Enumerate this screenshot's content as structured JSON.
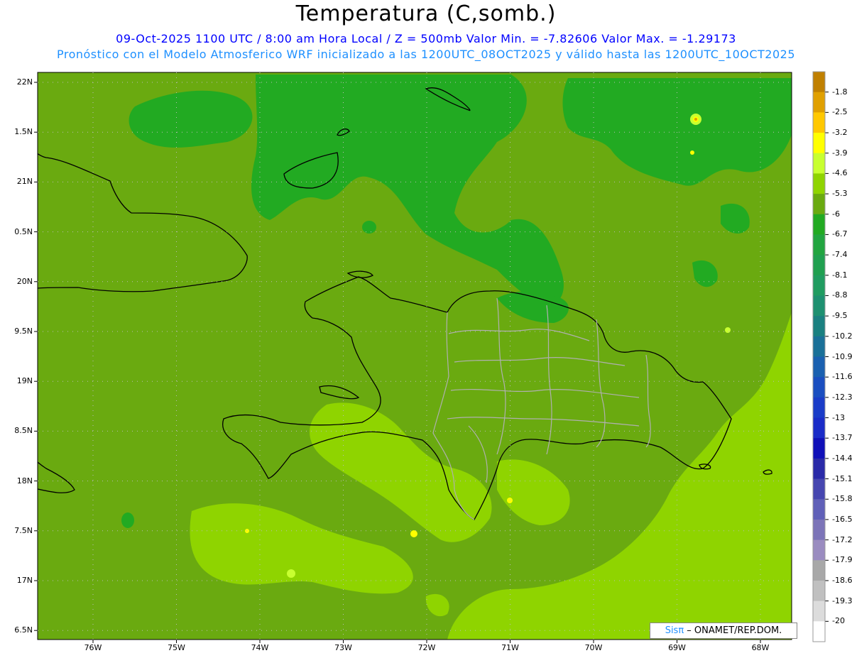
{
  "header": {
    "title": "Temperatura (C,somb.)",
    "line1": "09-Oct-2025  1100 UTC / 8:00 am Hora Local / Z = 500mb  Valor Min. = -7.82606  Valor Max. = -1.29173",
    "line2": "Pronóstico con el Modelo Atmosferico WRF inicializado a las 1200UTC_08OCT2025 y válido hasta las  1200UTC_10OCT2025"
  },
  "axes": {
    "lat_labels": [
      "22N",
      "1.5N",
      "21N",
      "0.5N",
      "20N",
      "9.5N",
      "19N",
      "8.5N",
      "18N",
      "7.5N",
      "17N",
      "6.5N"
    ],
    "lon_labels": [
      "76W",
      "75W",
      "74W",
      "73W",
      "72W",
      "71W",
      "70W",
      "69W",
      "68W"
    ]
  },
  "colorbar": {
    "labels": [
      "-1.8",
      "-2.5",
      "-3.2",
      "-3.9",
      "-4.6",
      "-5.3",
      "-6",
      "-6.7",
      "-7.4",
      "-8.1",
      "-8.8",
      "-9.5",
      "-10.2",
      "-10.9",
      "-11.6",
      "-12.3",
      "-13",
      "-13.7",
      "-14.4",
      "-15.1",
      "-15.8",
      "-16.5",
      "-17.2",
      "-17.9",
      "-18.6",
      "-19.3",
      "-20"
    ],
    "colors": [
      "#c08000",
      "#e0a000",
      "#ffc800",
      "#ffff00",
      "#c8ff30",
      "#8fd400",
      "#6aaa10",
      "#22aa22",
      "#22a540",
      "#20a050",
      "#209c60",
      "#1e9070",
      "#1a8080",
      "#1a7098",
      "#1a60b0",
      "#1a4ec0",
      "#1a3cc8",
      "#1a2cc8",
      "#1010b8",
      "#2a2aa8",
      "#4646b0",
      "#6060b8",
      "#7c74b8",
      "#9a8cc0",
      "#a8a8a8",
      "#c0c0c0",
      "#dcdcdc",
      "#ffffff"
    ]
  },
  "field_colors": {
    "base": "#6aaa10",
    "cool": "#22aa22",
    "warm": "#8fd400",
    "warmer": "#c8ff30",
    "hot": "#ffff00",
    "peak": "#e0a000",
    "coast": "#000000",
    "provinces": "#b0b0b0"
  },
  "credit": {
    "brand": "Sisπ",
    "org": " – ONAMET/REP.DOM."
  }
}
